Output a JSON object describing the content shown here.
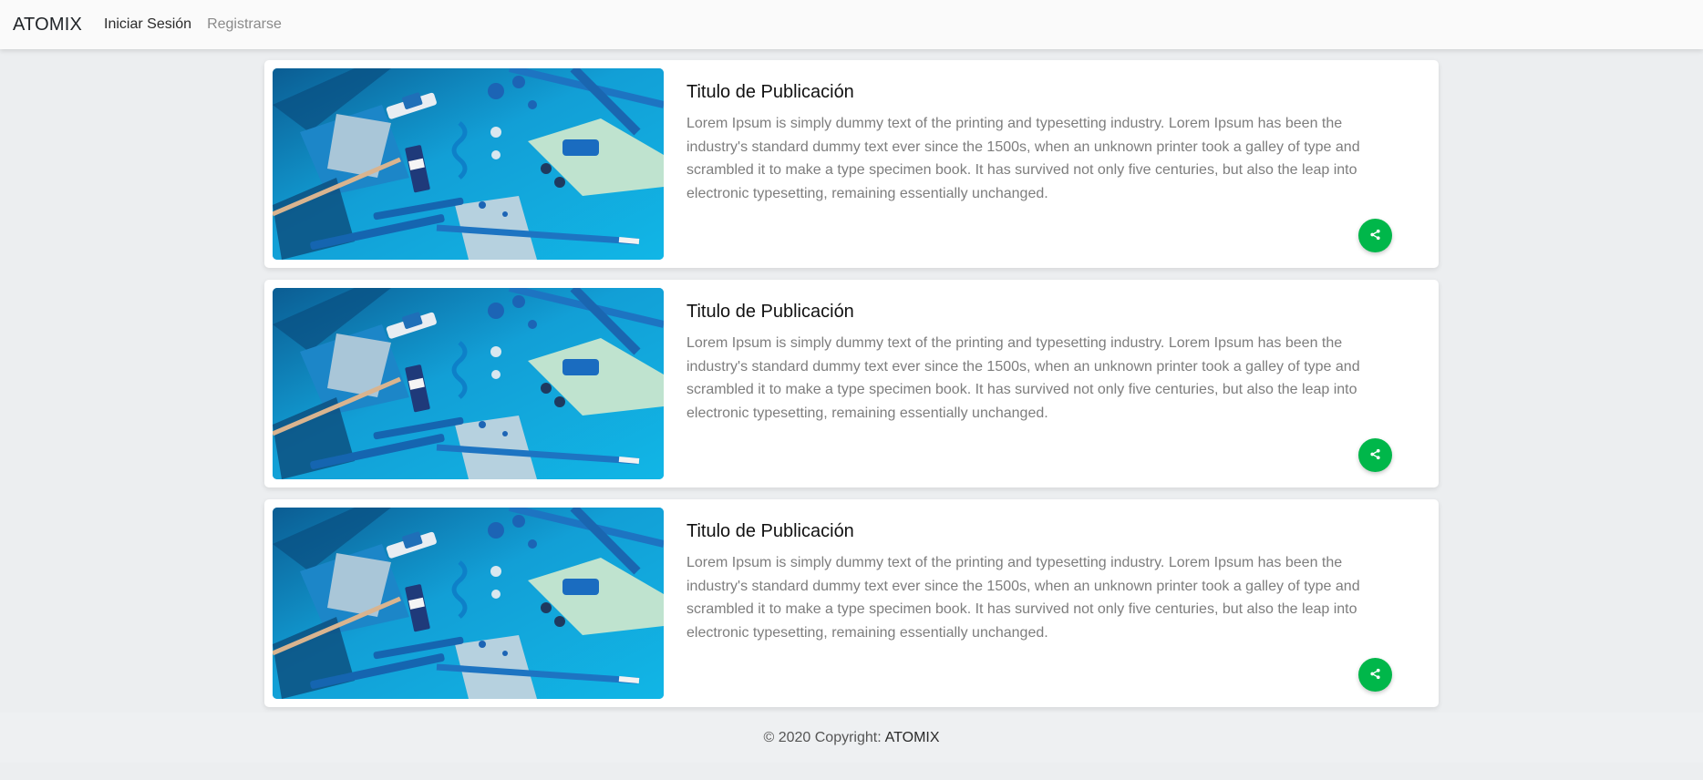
{
  "navbar": {
    "brand": "ATOMIX",
    "links": [
      {
        "label": "Iniciar Sesión",
        "active": true
      },
      {
        "label": "Registrarse",
        "active": false
      }
    ]
  },
  "cards": [
    {
      "title": "Titulo de Publicación",
      "text": "Lorem Ipsum is simply dummy text of the printing and typesetting industry. Lorem Ipsum has been the industry's standard dummy text ever since the 1500s, when an unknown printer took a galley of type and scrambled it to make a type specimen book. It has survived not only five centuries, but also the leap into electronic typesetting, remaining essentially unchanged.",
      "image_icon": "stationery-photo",
      "action_icon": "share-icon"
    },
    {
      "title": "Titulo de Publicación",
      "text": "Lorem Ipsum is simply dummy text of the printing and typesetting industry. Lorem Ipsum has been the industry's standard dummy text ever since the 1500s, when an unknown printer took a galley of type and scrambled it to make a type specimen book. It has survived not only five centuries, but also the leap into electronic typesetting, remaining essentially unchanged.",
      "image_icon": "stationery-photo",
      "action_icon": "share-icon"
    },
    {
      "title": "Titulo de Publicación",
      "text": "Lorem Ipsum is simply dummy text of the printing and typesetting industry. Lorem Ipsum has been the industry's standard dummy text ever since the 1500s, when an unknown printer took a galley of type and scrambled it to make a type specimen book. It has survived not only five centuries, but also the leap into electronic typesetting, remaining essentially unchanged.",
      "image_icon": "stationery-photo",
      "action_icon": "share-icon"
    }
  ],
  "footer": {
    "copyright": "© 2020 Copyright:",
    "brand": "ATOMIX"
  },
  "colors": {
    "share_button": "#00b74a",
    "image_blue": "#0f9bd3",
    "page_bg": "#eceef0"
  }
}
